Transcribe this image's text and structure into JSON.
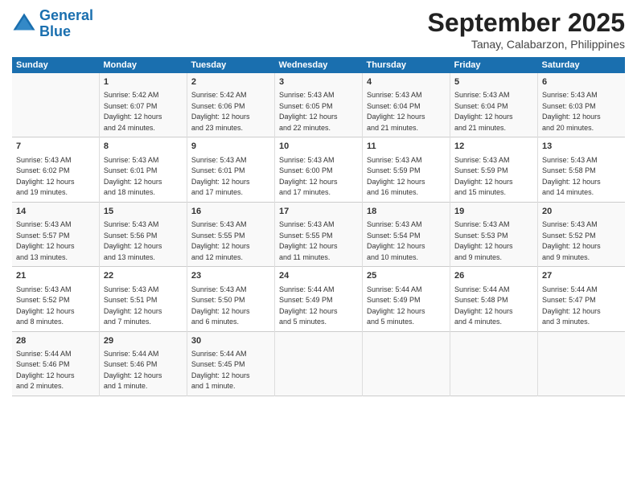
{
  "header": {
    "logo_line1": "General",
    "logo_line2": "Blue",
    "title": "September 2025",
    "subtitle": "Tanay, Calabarzon, Philippines"
  },
  "columns": [
    "Sunday",
    "Monday",
    "Tuesday",
    "Wednesday",
    "Thursday",
    "Friday",
    "Saturday"
  ],
  "weeks": [
    [
      {
        "day": "",
        "data": ""
      },
      {
        "day": "1",
        "data": "Sunrise: 5:42 AM\nSunset: 6:07 PM\nDaylight: 12 hours\nand 24 minutes."
      },
      {
        "day": "2",
        "data": "Sunrise: 5:42 AM\nSunset: 6:06 PM\nDaylight: 12 hours\nand 23 minutes."
      },
      {
        "day": "3",
        "data": "Sunrise: 5:43 AM\nSunset: 6:05 PM\nDaylight: 12 hours\nand 22 minutes."
      },
      {
        "day": "4",
        "data": "Sunrise: 5:43 AM\nSunset: 6:04 PM\nDaylight: 12 hours\nand 21 minutes."
      },
      {
        "day": "5",
        "data": "Sunrise: 5:43 AM\nSunset: 6:04 PM\nDaylight: 12 hours\nand 21 minutes."
      },
      {
        "day": "6",
        "data": "Sunrise: 5:43 AM\nSunset: 6:03 PM\nDaylight: 12 hours\nand 20 minutes."
      }
    ],
    [
      {
        "day": "7",
        "data": "Sunrise: 5:43 AM\nSunset: 6:02 PM\nDaylight: 12 hours\nand 19 minutes."
      },
      {
        "day": "8",
        "data": "Sunrise: 5:43 AM\nSunset: 6:01 PM\nDaylight: 12 hours\nand 18 minutes."
      },
      {
        "day": "9",
        "data": "Sunrise: 5:43 AM\nSunset: 6:01 PM\nDaylight: 12 hours\nand 17 minutes."
      },
      {
        "day": "10",
        "data": "Sunrise: 5:43 AM\nSunset: 6:00 PM\nDaylight: 12 hours\nand 17 minutes."
      },
      {
        "day": "11",
        "data": "Sunrise: 5:43 AM\nSunset: 5:59 PM\nDaylight: 12 hours\nand 16 minutes."
      },
      {
        "day": "12",
        "data": "Sunrise: 5:43 AM\nSunset: 5:59 PM\nDaylight: 12 hours\nand 15 minutes."
      },
      {
        "day": "13",
        "data": "Sunrise: 5:43 AM\nSunset: 5:58 PM\nDaylight: 12 hours\nand 14 minutes."
      }
    ],
    [
      {
        "day": "14",
        "data": "Sunrise: 5:43 AM\nSunset: 5:57 PM\nDaylight: 12 hours\nand 13 minutes."
      },
      {
        "day": "15",
        "data": "Sunrise: 5:43 AM\nSunset: 5:56 PM\nDaylight: 12 hours\nand 13 minutes."
      },
      {
        "day": "16",
        "data": "Sunrise: 5:43 AM\nSunset: 5:55 PM\nDaylight: 12 hours\nand 12 minutes."
      },
      {
        "day": "17",
        "data": "Sunrise: 5:43 AM\nSunset: 5:55 PM\nDaylight: 12 hours\nand 11 minutes."
      },
      {
        "day": "18",
        "data": "Sunrise: 5:43 AM\nSunset: 5:54 PM\nDaylight: 12 hours\nand 10 minutes."
      },
      {
        "day": "19",
        "data": "Sunrise: 5:43 AM\nSunset: 5:53 PM\nDaylight: 12 hours\nand 9 minutes."
      },
      {
        "day": "20",
        "data": "Sunrise: 5:43 AM\nSunset: 5:52 PM\nDaylight: 12 hours\nand 9 minutes."
      }
    ],
    [
      {
        "day": "21",
        "data": "Sunrise: 5:43 AM\nSunset: 5:52 PM\nDaylight: 12 hours\nand 8 minutes."
      },
      {
        "day": "22",
        "data": "Sunrise: 5:43 AM\nSunset: 5:51 PM\nDaylight: 12 hours\nand 7 minutes."
      },
      {
        "day": "23",
        "data": "Sunrise: 5:43 AM\nSunset: 5:50 PM\nDaylight: 12 hours\nand 6 minutes."
      },
      {
        "day": "24",
        "data": "Sunrise: 5:44 AM\nSunset: 5:49 PM\nDaylight: 12 hours\nand 5 minutes."
      },
      {
        "day": "25",
        "data": "Sunrise: 5:44 AM\nSunset: 5:49 PM\nDaylight: 12 hours\nand 5 minutes."
      },
      {
        "day": "26",
        "data": "Sunrise: 5:44 AM\nSunset: 5:48 PM\nDaylight: 12 hours\nand 4 minutes."
      },
      {
        "day": "27",
        "data": "Sunrise: 5:44 AM\nSunset: 5:47 PM\nDaylight: 12 hours\nand 3 minutes."
      }
    ],
    [
      {
        "day": "28",
        "data": "Sunrise: 5:44 AM\nSunset: 5:46 PM\nDaylight: 12 hours\nand 2 minutes."
      },
      {
        "day": "29",
        "data": "Sunrise: 5:44 AM\nSunset: 5:46 PM\nDaylight: 12 hours\nand 1 minute."
      },
      {
        "day": "30",
        "data": "Sunrise: 5:44 AM\nSunset: 5:45 PM\nDaylight: 12 hours\nand 1 minute."
      },
      {
        "day": "",
        "data": ""
      },
      {
        "day": "",
        "data": ""
      },
      {
        "day": "",
        "data": ""
      },
      {
        "day": "",
        "data": ""
      }
    ]
  ]
}
